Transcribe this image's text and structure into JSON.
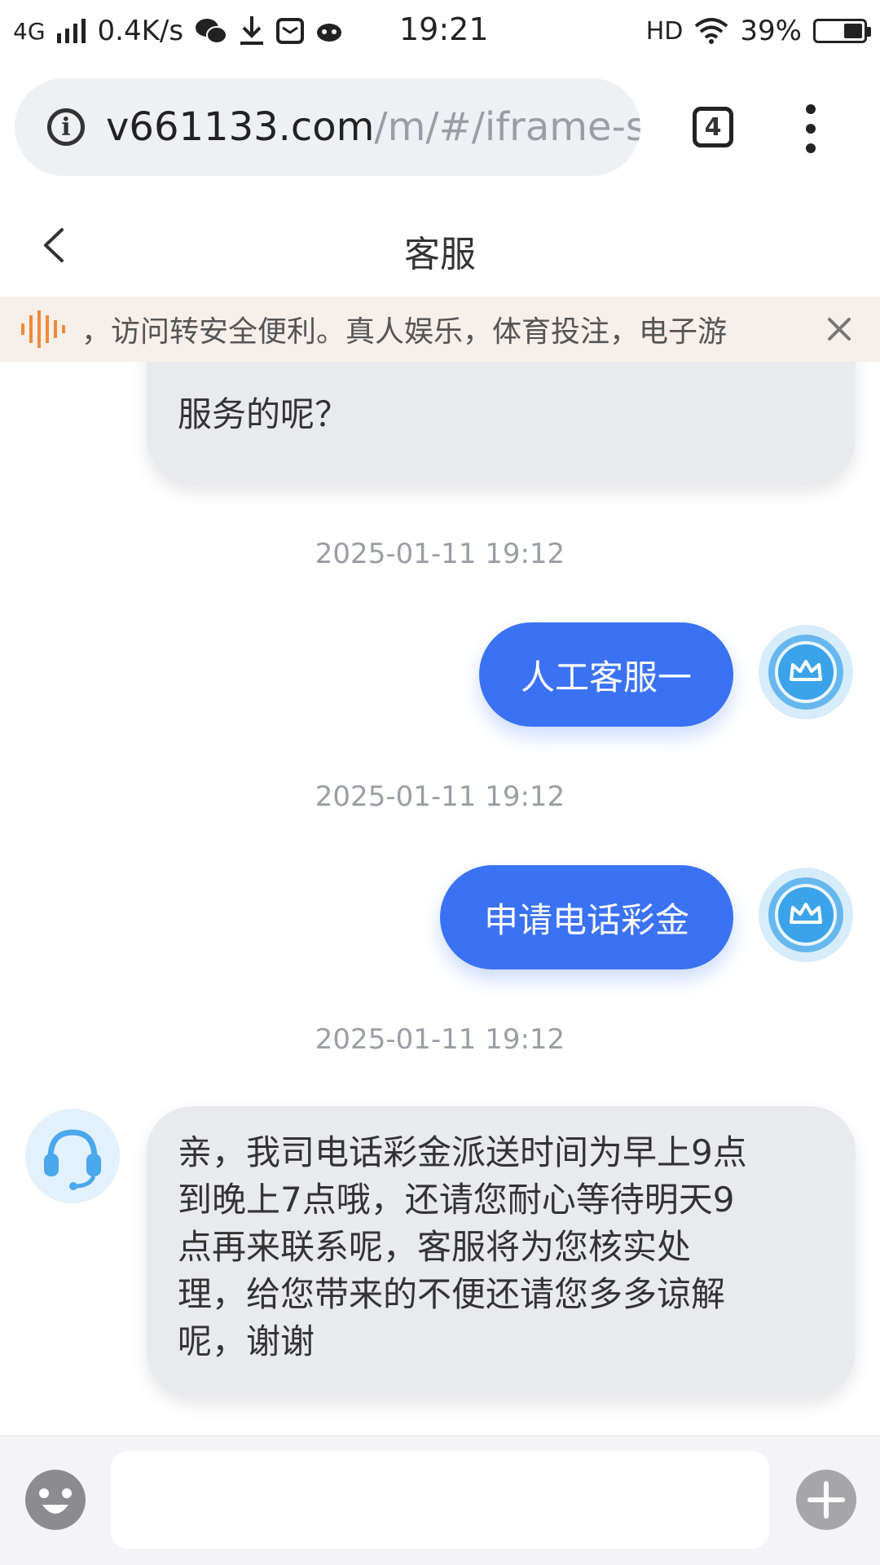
{
  "status_bar": {
    "network": "4G",
    "speed": "0.4K/s",
    "time": "19:21",
    "hd": "HD",
    "battery": "39%",
    "battery_level": 0.39
  },
  "browser": {
    "url_host": "v661133.com",
    "url_path": "/m/#/iframe-s",
    "tab_count": "4"
  },
  "page": {
    "title": "客服"
  },
  "notice": {
    "text": "，访问转安全便利。真人娱乐，体育投注，电子游"
  },
  "messages": [
    {
      "type": "incoming_partial",
      "text": "服务的呢？"
    },
    {
      "type": "timestamp",
      "text": "2025-01-11 19:12"
    },
    {
      "type": "outgoing",
      "text": "人工客服一"
    },
    {
      "type": "timestamp",
      "text": "2025-01-11 19:12"
    },
    {
      "type": "outgoing",
      "text": "申请电话彩金"
    },
    {
      "type": "timestamp",
      "text": "2025-01-11 19:12"
    },
    {
      "type": "incoming",
      "lines": [
        "亲，我司电话彩金派送时间为早上9点",
        "到晚上7点哦，还请您耐心等待明天9",
        "点再来联系呢，客服将为您核实处",
        "理，给您带来的不便还请您多多谅解",
        "呢，谢谢"
      ]
    }
  ],
  "input": {
    "placeholder": ""
  },
  "colors": {
    "accent": "#3b72f4",
    "incoming_bubble": "#e9eaee",
    "notice_bg": "#f6efea",
    "notice_icon": "#f08a3a"
  }
}
